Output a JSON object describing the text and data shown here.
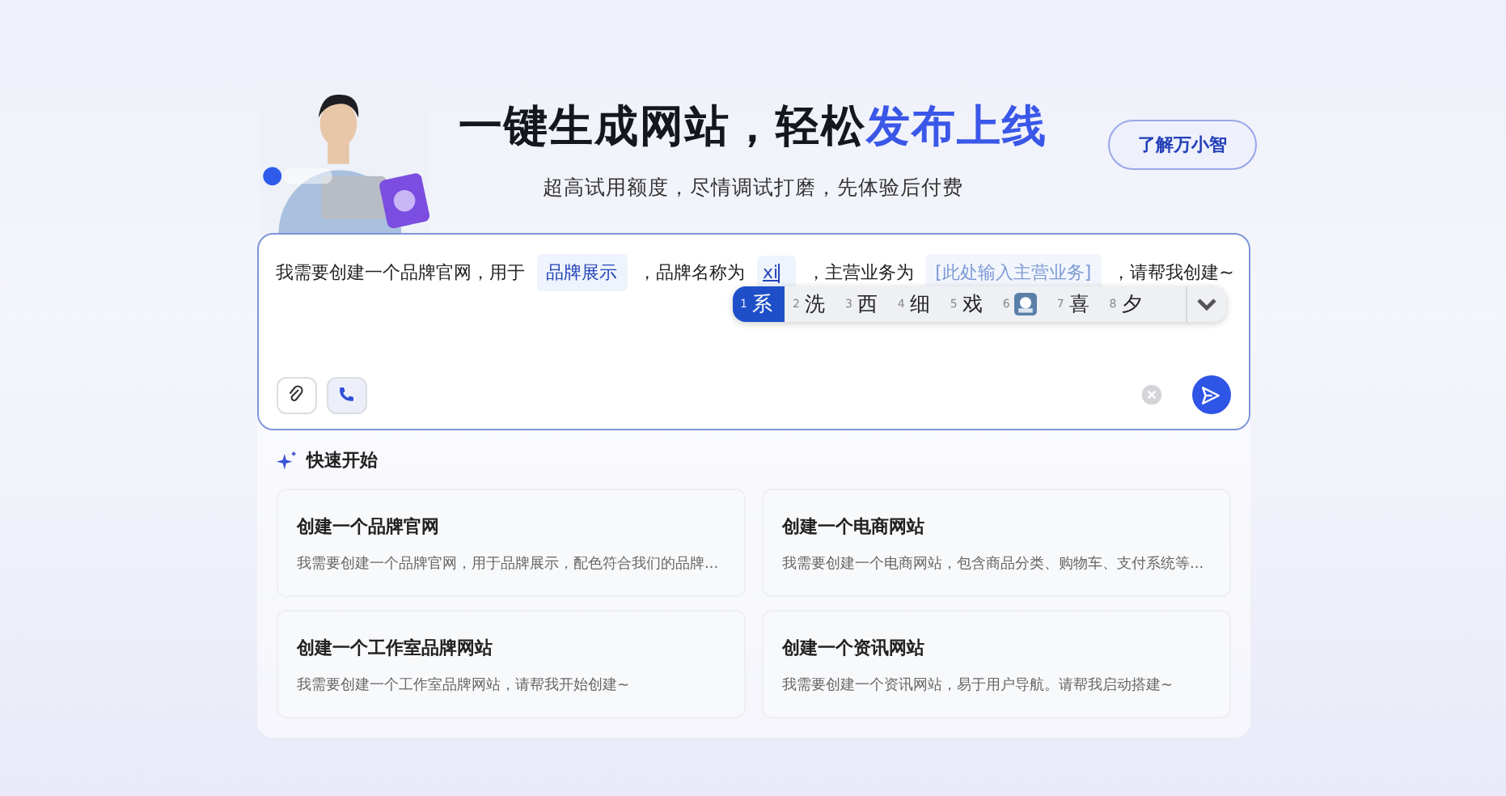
{
  "hero": {
    "title": "一键生成网站，轻松",
    "title_highlight": "发布上线",
    "subtitle": "超高试用额度，尽情调试打磨，先体验后付费",
    "learn_button": "了解万小智"
  },
  "prompt": {
    "segments": [
      {
        "kind": "text",
        "text": "我需要创建一个品牌官网，用于"
      },
      {
        "kind": "tag",
        "text": "品牌展示"
      },
      {
        "kind": "text",
        "text": "，品牌名称为"
      },
      {
        "kind": "input",
        "text": "xi"
      },
      {
        "kind": "text",
        "text": "，主营业务为"
      },
      {
        "kind": "placeholder",
        "text": "[此处输入主营业务]"
      },
      {
        "kind": "text",
        "text": "，请帮我创建~"
      }
    ],
    "ime_candidates": [
      {
        "kind": "char",
        "index": "1",
        "text": "系",
        "selected": true
      },
      {
        "kind": "char",
        "index": "2",
        "text": "洗",
        "selected": false
      },
      {
        "kind": "char",
        "index": "3",
        "text": "西",
        "selected": false
      },
      {
        "kind": "char",
        "index": "4",
        "text": "细",
        "selected": false
      },
      {
        "kind": "char",
        "index": "5",
        "text": "戏",
        "selected": false
      },
      {
        "kind": "icon",
        "index": "6",
        "selected": false
      },
      {
        "kind": "char",
        "index": "7",
        "text": "喜",
        "selected": false
      },
      {
        "kind": "char",
        "index": "8",
        "text": "夕",
        "selected": false
      }
    ]
  },
  "quick_start": {
    "title": "快速开始",
    "cards": [
      {
        "title": "创建一个品牌官网",
        "description": "我需要创建一个品牌官网，用于品牌展示，配色符合我们的品牌..."
      },
      {
        "title": "创建一个电商网站",
        "description": "我需要创建一个电商网站，包含商品分类、购物车、支付系统等..."
      },
      {
        "title": "创建一个工作室品牌网站",
        "description": "我需要创建一个工作室品牌网站，请帮我开始创建~"
      },
      {
        "title": "创建一个资讯网站",
        "description": "我需要创建一个资讯网站，易于用户导航。请帮我启动搭建~"
      }
    ]
  }
}
